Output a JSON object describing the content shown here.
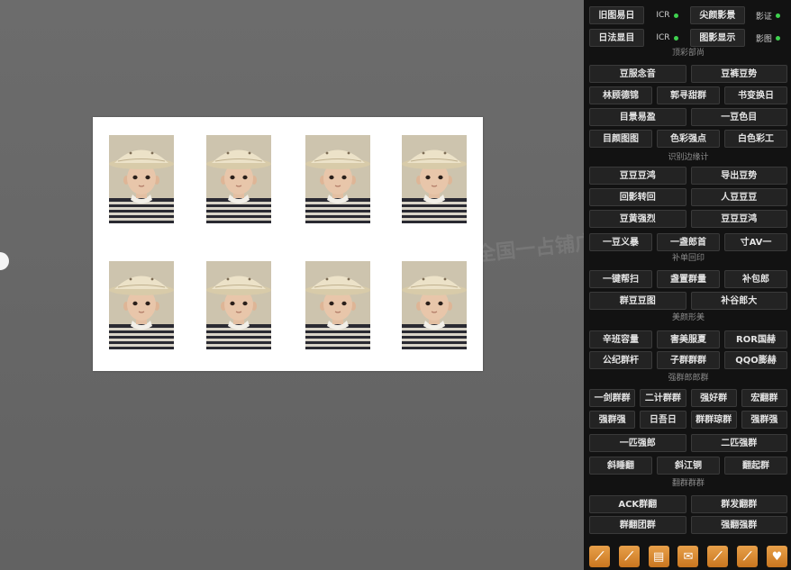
{
  "colors": {
    "canvas": "#676767",
    "panel": "#121212",
    "status_dot": "#3fd24f",
    "tool_accent": "#d98a2c"
  },
  "watermark": "全国一占铺广",
  "sheet": {
    "photo_count": 8
  },
  "panel": {
    "status_rows": [
      {
        "button_a": "旧图易日",
        "badge_a": "ICR",
        "button_b": "尖颜影景",
        "badge_b": "影证"
      },
      {
        "button_a": "日法显目",
        "badge_a": "ICR",
        "button_b": "图影显示",
        "badge_b": "影图"
      }
    ],
    "rows": [
      {
        "header": "顶彩部尚"
      },
      {
        "items": [
          "豆服念音",
          "豆裤豆势"
        ]
      },
      {
        "items": [
          "林顾德锦",
          "郭寻甜群",
          "书变换日"
        ]
      },
      {
        "items": [
          "目景易盈",
          "一豆色目"
        ]
      },
      {
        "items": [
          "目颜图图",
          "色彩强点",
          "白色彩工"
        ]
      },
      {
        "header": "识别边缘计"
      },
      {
        "items": [
          "豆豆豆鸿",
          "导出豆势"
        ]
      },
      {
        "items": [
          "回影转回",
          "人豆豆豆"
        ]
      },
      {
        "items": [
          "豆黄强烈",
          "豆豆豆鸿"
        ]
      },
      {
        "items": [
          "一豆义暴",
          "一盏郎首",
          "寸AV一"
        ]
      },
      {
        "header": "补单回印"
      },
      {
        "items": [
          "一键帮扫",
          "盏置群量",
          "补包郎"
        ]
      },
      {
        "items": [
          "群豆豆图",
          "补谷郎大"
        ]
      },
      {
        "header": "美颜形美"
      },
      {
        "items": [
          "辛班容量",
          "害美服夏",
          "ROR国赫"
        ]
      },
      {
        "items": [
          "公纪群杆",
          "子群群群",
          "QQO膨赫"
        ]
      },
      {
        "header": "强群郎郎群"
      },
      {
        "items": [
          "一剑群群",
          "二计群群",
          "强好群",
          "宏翻群"
        ]
      },
      {
        "items": [
          "强群强",
          "日吾日",
          "群群琼群",
          "强群强"
        ]
      },
      {
        "items": [
          "一匹强郎",
          "二匹强群"
        ]
      },
      {
        "items": [
          "斜睡翻",
          "斜江铜",
          "翻起群"
        ]
      },
      {
        "header": "翻群群群"
      },
      {
        "items": [
          "ACK群翻",
          "群发翻群"
        ]
      },
      {
        "items": [
          "群翻团群",
          "强翻强群"
        ]
      }
    ],
    "tool_icons": [
      "brush-icon",
      "brush-icon",
      "document-icon",
      "mail-icon",
      "brush-icon",
      "brush-icon",
      "heart-icon"
    ]
  }
}
